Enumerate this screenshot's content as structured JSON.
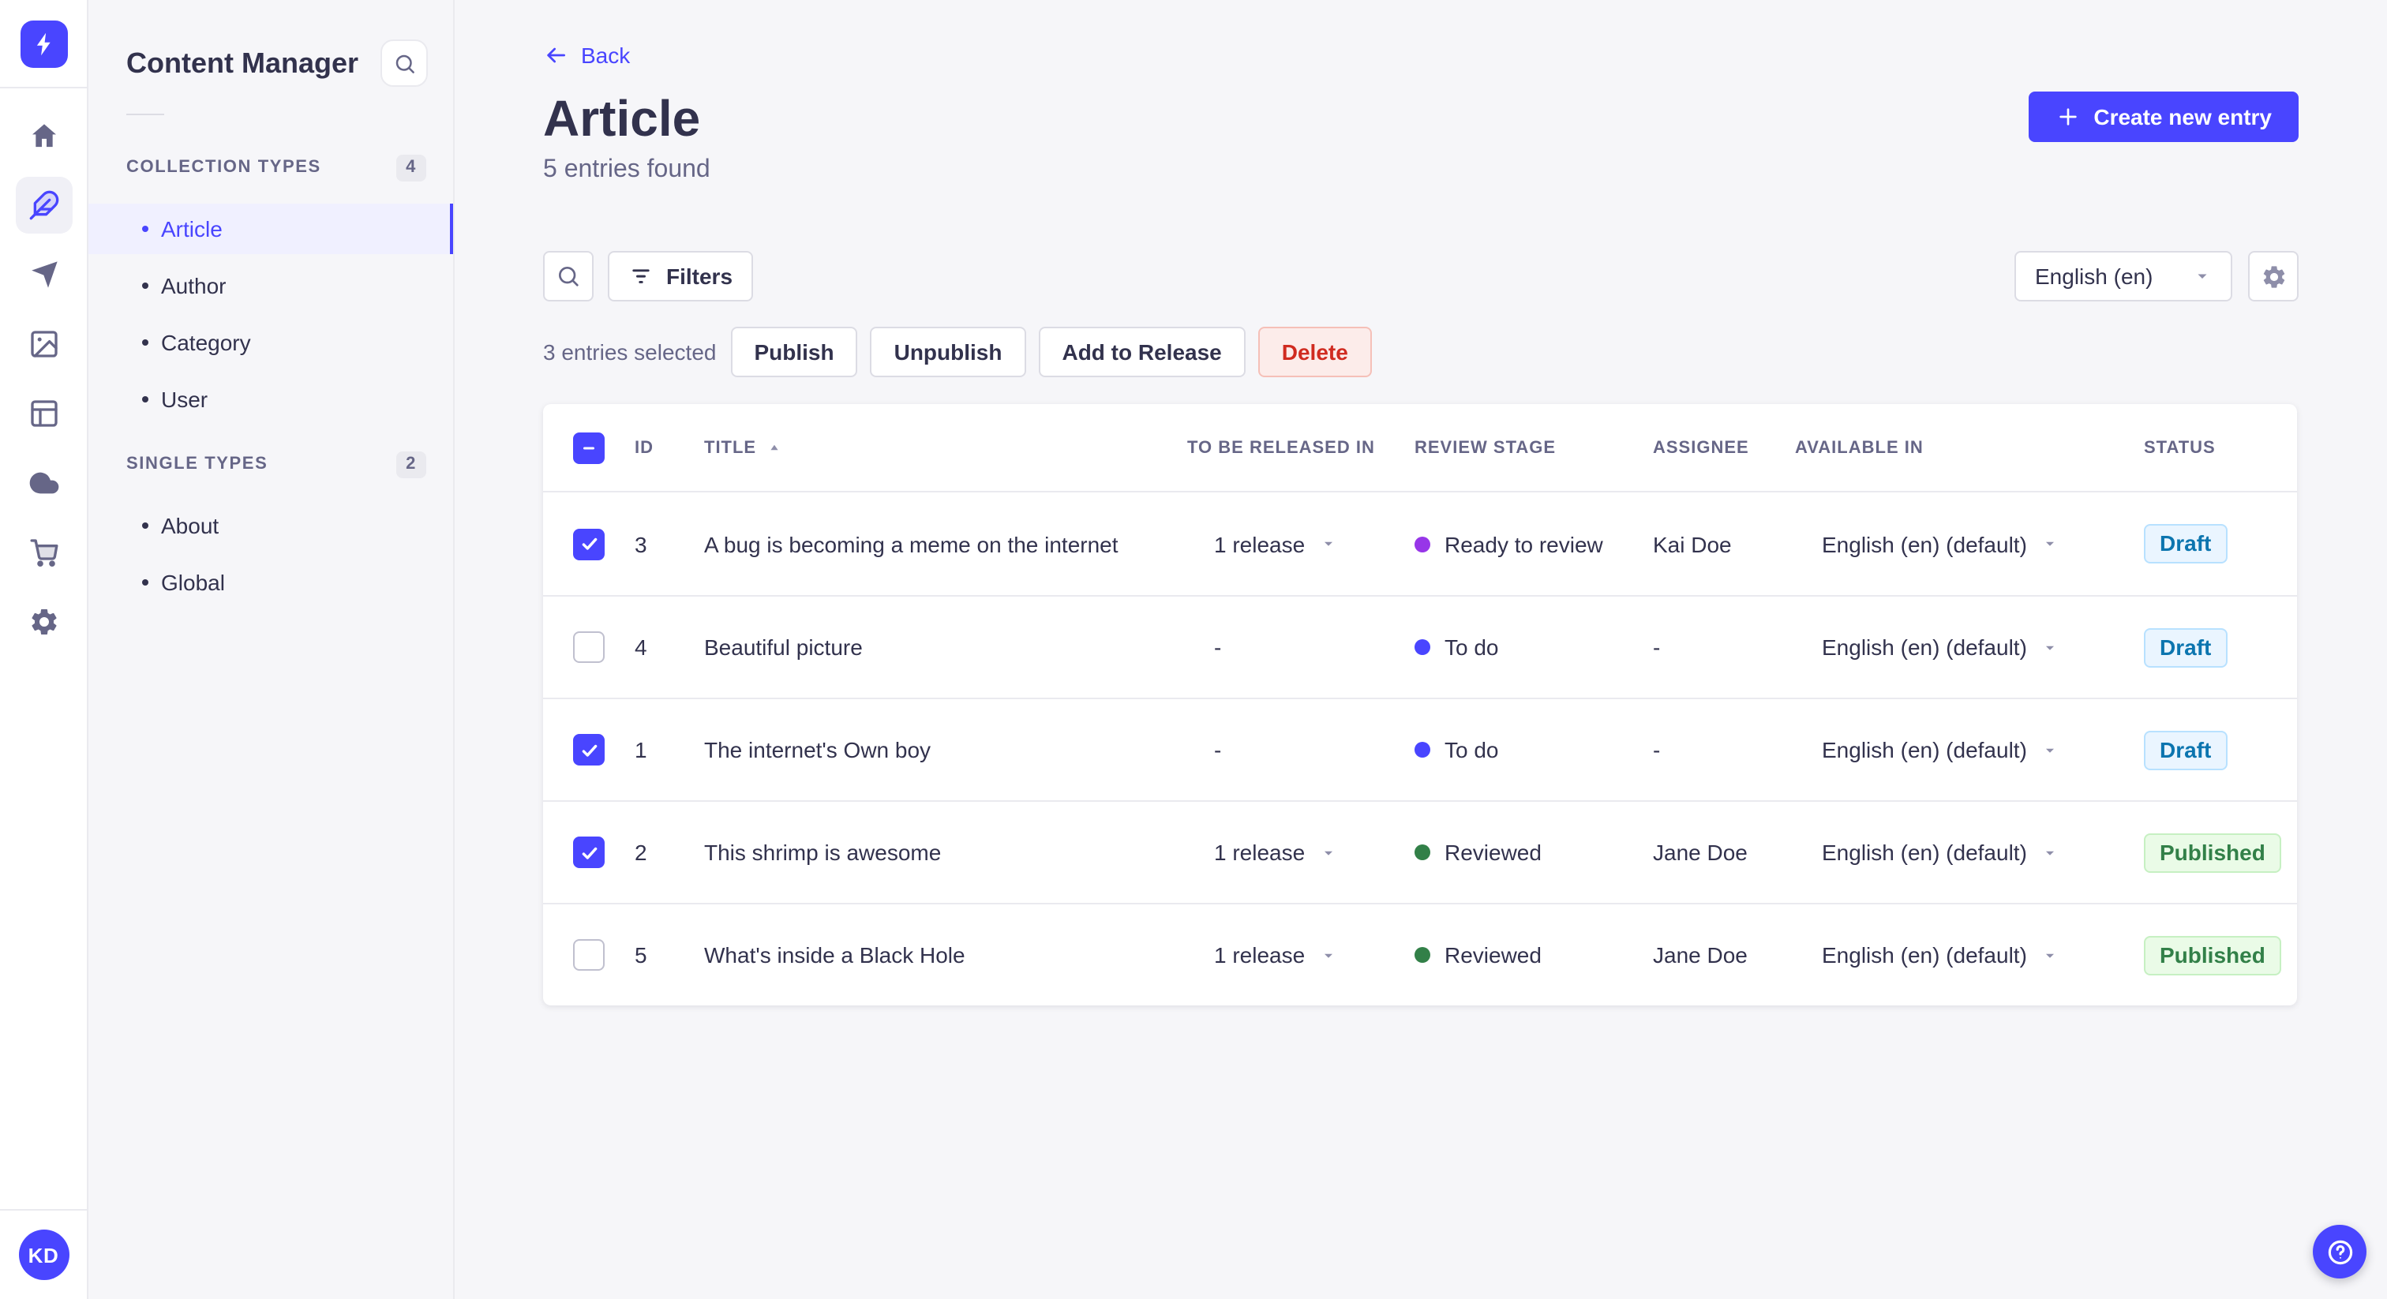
{
  "app": {
    "title": "Content Manager"
  },
  "colors": {
    "primary": "#4945FF",
    "stage_todo_dot": "#4945FF",
    "stage_ready_dot": "#9736E8",
    "stage_reviewed_dot": "#328048",
    "draft_badge_text": "#0C75AF",
    "published_badge_text": "#328048",
    "delete_button_text": "#D02B20"
  },
  "nav_rail": {
    "logo_icon": "strapi-logo-icon",
    "icons": [
      {
        "name": "home-icon",
        "state": ""
      },
      {
        "name": "feather-content-icon",
        "state": "active"
      },
      {
        "name": "send-icon",
        "state": ""
      },
      {
        "name": "media-library-icon",
        "state": ""
      },
      {
        "name": "layout-icon",
        "state": ""
      },
      {
        "name": "cloud-icon",
        "state": ""
      },
      {
        "name": "cart-icon",
        "state": ""
      },
      {
        "name": "gear-icon",
        "state": ""
      }
    ],
    "avatar_initials": "KD"
  },
  "sidebar": {
    "title": "Content Manager",
    "search_icon": "search-icon",
    "sections": [
      {
        "label": "COLLECTION TYPES",
        "count": "4",
        "items": [
          {
            "label": "Article",
            "state": "active"
          },
          {
            "label": "Author",
            "state": ""
          },
          {
            "label": "Category",
            "state": ""
          },
          {
            "label": "User",
            "state": ""
          }
        ]
      },
      {
        "label": "SINGLE TYPES",
        "count": "2",
        "items": [
          {
            "label": "About",
            "state": ""
          },
          {
            "label": "Global",
            "state": ""
          }
        ]
      }
    ]
  },
  "header": {
    "back_label": "Back",
    "title": "Article",
    "subtitle": "5 entries found",
    "create_button": "Create new entry"
  },
  "toolbar": {
    "filters_label": "Filters",
    "locale_value": "English (en)"
  },
  "selection": {
    "summary": "3 entries selected",
    "publish_label": "Publish",
    "unpublish_label": "Unpublish",
    "add_to_release_label": "Add to Release",
    "delete_label": "Delete"
  },
  "table": {
    "select_all_state": "indeterminate",
    "sort_column": "TITLE",
    "sort_direction": "asc",
    "columns": {
      "id": "ID",
      "title": "TITLE",
      "release": "TO BE RELEASED IN",
      "stage": "REVIEW STAGE",
      "assignee": "ASSIGNEE",
      "available": "AVAILABLE IN",
      "status": "STATUS"
    },
    "rows": [
      {
        "check": "checked",
        "id": "3",
        "title": "A bug is becoming a meme on the internet",
        "release": "1 release",
        "release_kind": "has-release",
        "stage": "Ready to review",
        "stage_color": "dot-purple",
        "assignee": "Kai Doe",
        "available": "English (en) (default)",
        "status": "Draft",
        "status_variant": "badge-draft"
      },
      {
        "check": "unchecked",
        "id": "4",
        "title": "Beautiful picture",
        "release": "-",
        "release_kind": "no-release",
        "stage": "To do",
        "stage_color": "dot-blue",
        "assignee": "-",
        "available": "English (en) (default)",
        "status": "Draft",
        "status_variant": "badge-draft"
      },
      {
        "check": "checked",
        "id": "1",
        "title": "The internet's Own boy",
        "release": "-",
        "release_kind": "no-release",
        "stage": "To do",
        "stage_color": "dot-blue",
        "assignee": "-",
        "available": "English (en) (default)",
        "status": "Draft",
        "status_variant": "badge-draft"
      },
      {
        "check": "checked",
        "id": "2",
        "title": "This shrimp is awesome",
        "release": "1 release",
        "release_kind": "has-release",
        "stage": "Reviewed",
        "stage_color": "dot-green",
        "assignee": "Jane Doe",
        "available": "English (en) (default)",
        "status": "Published",
        "status_variant": "badge-published"
      },
      {
        "check": "unchecked",
        "id": "5",
        "title": "What's inside a Black Hole",
        "release": "1 release",
        "release_kind": "has-release",
        "stage": "Reviewed",
        "stage_color": "dot-green",
        "assignee": "Jane Doe",
        "available": "English (en) (default)",
        "status": "Published",
        "status_variant": "badge-published"
      }
    ]
  },
  "fab": {
    "icon": "help-icon"
  }
}
